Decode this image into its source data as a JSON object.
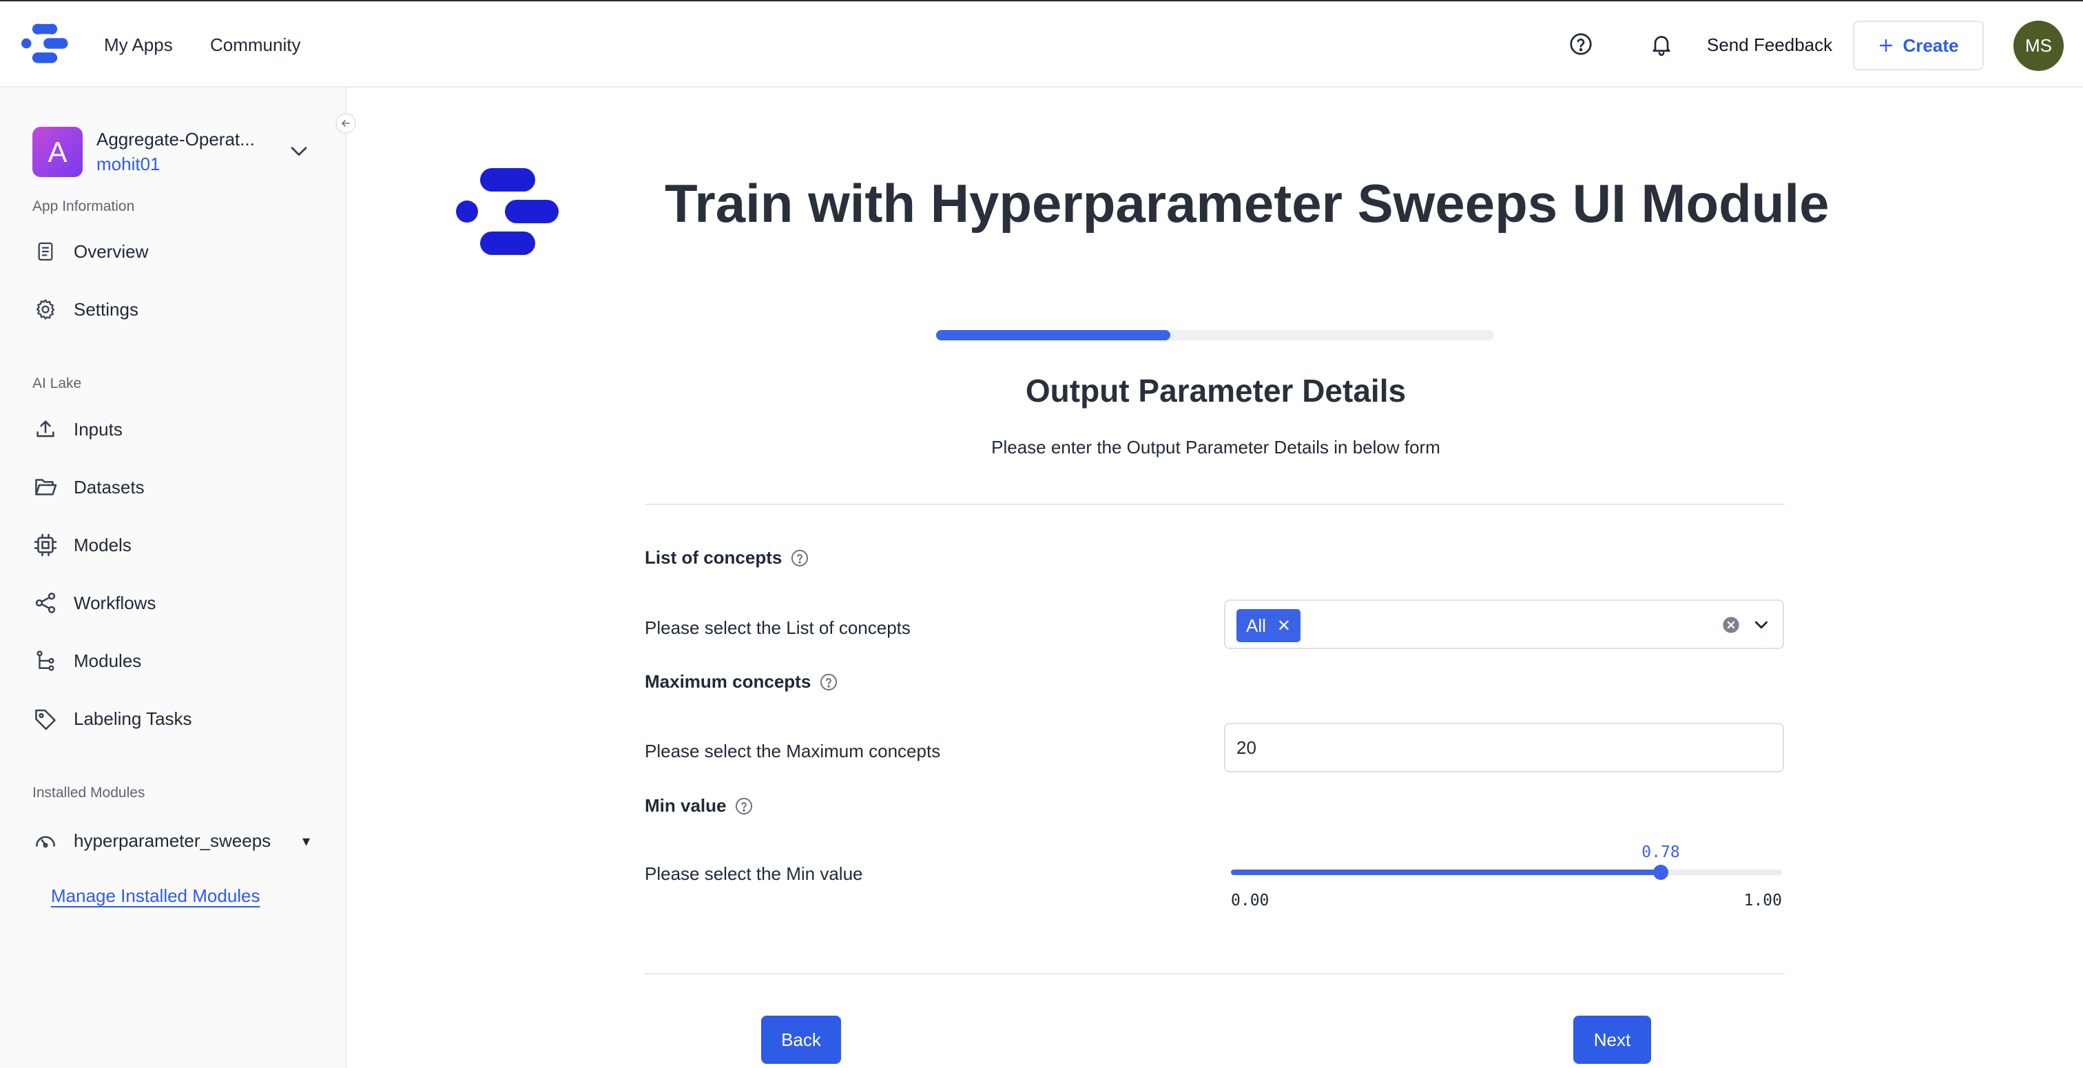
{
  "topbar": {
    "nav": {
      "my_apps": "My Apps",
      "community": "Community"
    },
    "send_feedback": "Send Feedback",
    "create_label": "Create",
    "avatar_initials": "MS"
  },
  "sidebar": {
    "app": {
      "initial": "A",
      "name": "Aggregate-Operat...",
      "user": "mohit01"
    },
    "sections": {
      "app_information": "App Information",
      "ai_lake": "AI Lake",
      "installed_modules": "Installed Modules"
    },
    "items": {
      "overview": "Overview",
      "settings": "Settings",
      "inputs": "Inputs",
      "datasets": "Datasets",
      "models": "Models",
      "workflows": "Workflows",
      "modules": "Modules",
      "labeling_tasks": "Labeling Tasks"
    },
    "installed_module": "hyperparameter_sweeps",
    "manage_link": "Manage Installed Modules"
  },
  "main": {
    "title": "Train with Hyperparameter Sweeps UI Module",
    "progress": 0.42,
    "section_title": "Output Parameter Details",
    "section_subtitle": "Please enter the Output Parameter Details in below form",
    "fields": {
      "concepts": {
        "heading": "List of concepts",
        "label": "Please select the List of concepts",
        "chip": "All"
      },
      "max_concepts": {
        "heading": "Maximum concepts",
        "label": "Please select the Maximum concepts",
        "value": "20"
      },
      "min_value": {
        "heading": "Min value",
        "label": "Please select the Min value",
        "value": 0.78,
        "value_text": "0.78",
        "min_text": "0.00",
        "max_text": "1.00"
      }
    },
    "buttons": {
      "back": "Back",
      "next": "Next"
    }
  },
  "colors": {
    "accent": "#2f5ce6",
    "logo": "#1a1fd6",
    "avatar_bg": "#4d5b26"
  },
  "icons": {
    "logo": "clarifai-logo",
    "help": "help-circle-icon",
    "bell": "bell-icon",
    "plus": "plus-icon"
  }
}
